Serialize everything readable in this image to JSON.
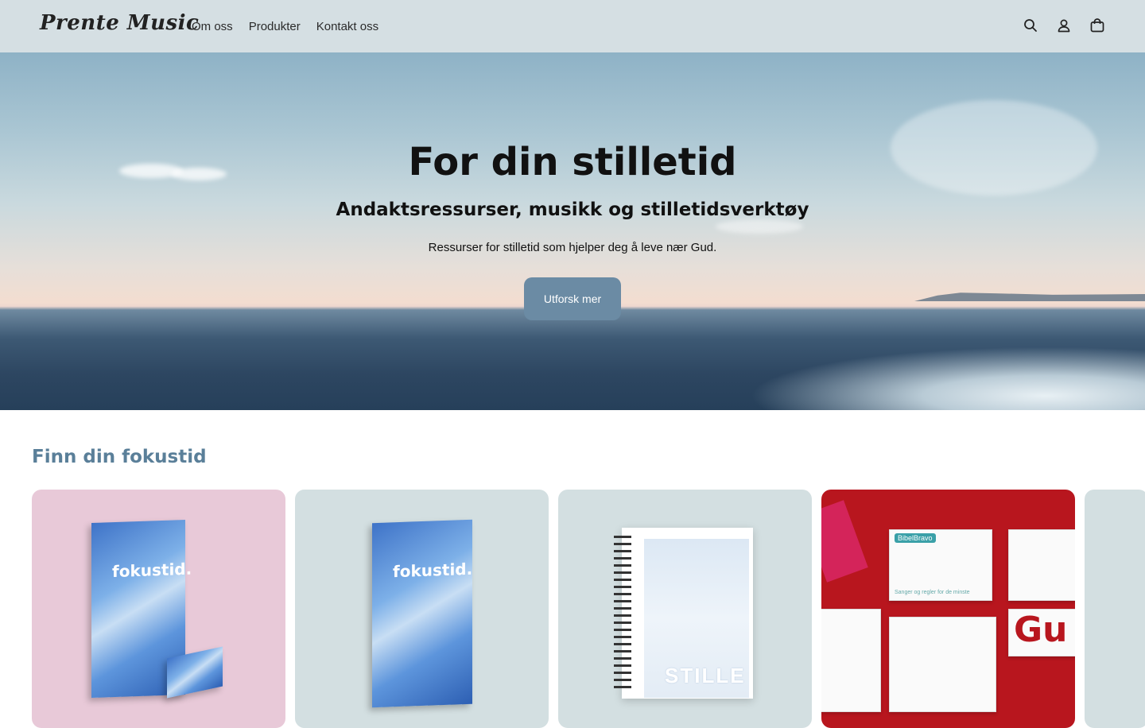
{
  "header": {
    "logo": "Prente Music",
    "nav": [
      {
        "label": "Om oss"
      },
      {
        "label": "Produkter"
      },
      {
        "label": "Kontakt oss"
      }
    ]
  },
  "hero": {
    "title": "For din stilletid",
    "subtitle": "Andaktsressurser, musikk og stilletidsverktøy",
    "description": "Ressurser for stilletid som hjelper deg å leve nær Gud.",
    "button": "Utforsk mer"
  },
  "section": {
    "title": "Finn din fokustid"
  },
  "cards": [
    {
      "background": "#e8c9d8",
      "book_text": "fokustid."
    },
    {
      "background": "#d3dfe1",
      "book_text": "fokustid."
    },
    {
      "background": "#d3dfe1",
      "book_text": "STILLE"
    },
    {
      "background": "#b8161e",
      "brand": "BibelBravo",
      "word": "Gu",
      "caption": "Sanger og regler for de minste"
    }
  ],
  "colors": {
    "header_bg": "#d5dfe3",
    "accent": "#6b8ba4",
    "section_title": "#5a7f99"
  }
}
